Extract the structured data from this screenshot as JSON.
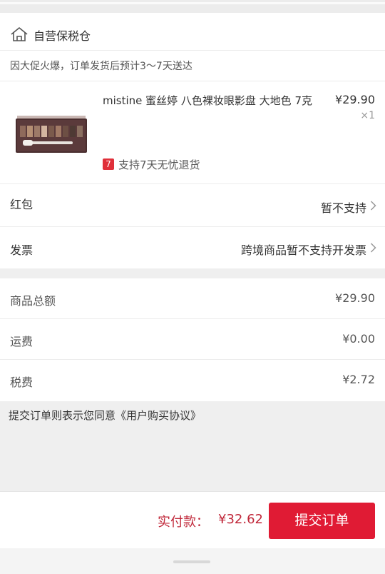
{
  "store": {
    "name": "自营保税仓",
    "icon": "home-icon"
  },
  "notice": "因大促火爆，订单发货后预计3～7天送达",
  "product": {
    "name": "mistine 蜜丝婷 八色裸妆眼影盘 大地色 7克",
    "price": "¥29.90",
    "quantity": "×1",
    "return_badge": "7",
    "return_policy": "支持7天无忧退货"
  },
  "options": {
    "red_packet": {
      "label": "红包",
      "value": "暂不支持"
    },
    "invoice": {
      "label": "发票",
      "value": "跨境商品暂不支持开发票"
    }
  },
  "summary": {
    "goods_total": {
      "label": "商品总额",
      "amount": "¥29.90"
    },
    "shipping": {
      "label": "运费",
      "amount": "¥0.00"
    },
    "tax": {
      "label": "税费",
      "amount": "¥2.72"
    }
  },
  "agreement": "提交订单则表示您同意《用户购买协议》",
  "footer": {
    "pay_label": "实付款：",
    "pay_amount": "¥32.62",
    "submit_label": "提交订单"
  },
  "colors": {
    "accent": "#e01b34",
    "pay_text": "#c0283a"
  }
}
